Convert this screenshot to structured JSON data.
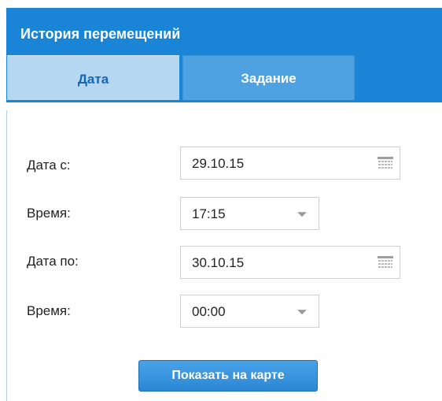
{
  "window": {
    "title": "История перемещений"
  },
  "tabs": [
    {
      "label": "Дата",
      "active": true
    },
    {
      "label": "Задание",
      "active": false
    }
  ],
  "form": {
    "date_from": {
      "label": "Дата с:",
      "value": "29.10.15",
      "icon": "calendar-icon"
    },
    "time_from": {
      "label": "Время:",
      "value": "17:15",
      "icon": "chevron-down-icon"
    },
    "date_to": {
      "label": "Дата по:",
      "value": "30.10.15",
      "icon": "calendar-icon"
    },
    "time_to": {
      "label": "Время:",
      "value": "00:00",
      "icon": "chevron-down-icon"
    }
  },
  "actions": {
    "show_on_map_label": "Показать на карте"
  },
  "colors": {
    "header_bg": "#1a84d6",
    "active_tab_bg": "#b6d7f2",
    "active_tab_text": "#1566b6",
    "inactive_tab_bg": "#4ea2e2",
    "button_bg": "#2b86d3"
  }
}
